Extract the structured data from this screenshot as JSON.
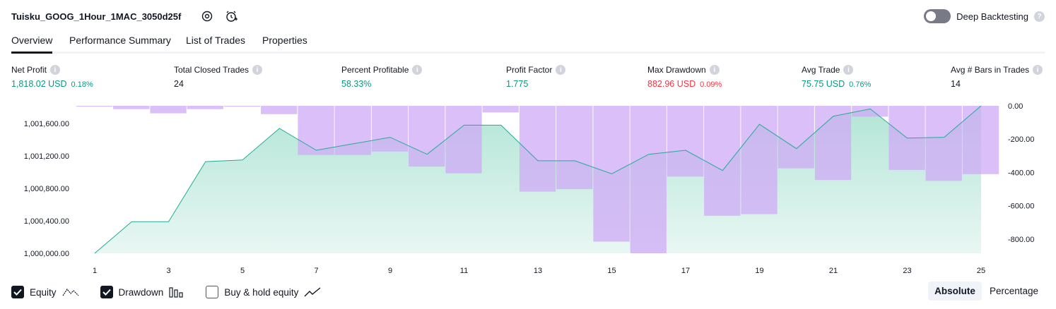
{
  "header": {
    "strategy_name": "Tuisku_GOOG_1Hour_1MAC_3050d25f",
    "settings_icon": "settings-gear-icon",
    "alert_icon": "add-alert-clock-icon",
    "deep_backtesting_label": "Deep Backtesting",
    "deep_backtesting_enabled": false,
    "help_icon_glyph": "?"
  },
  "tabs": [
    {
      "label": "Overview",
      "active": true
    },
    {
      "label": "Performance Summary",
      "active": false
    },
    {
      "label": "List of Trades",
      "active": false
    },
    {
      "label": "Properties",
      "active": false
    }
  ],
  "metrics": [
    {
      "label": "Net Profit",
      "value": "1,818.02 USD",
      "pct": "0.18%",
      "color": "green"
    },
    {
      "label": "Total Closed Trades",
      "value": "24",
      "pct": "",
      "color": "dark"
    },
    {
      "label": "Percent Profitable",
      "value": "58.33%",
      "pct": "",
      "color": "green"
    },
    {
      "label": "Profit Factor",
      "value": "1.775",
      "pct": "",
      "color": "green"
    },
    {
      "label": "Max Drawdown",
      "value": "882.96 USD",
      "pct": "0.09%",
      "color": "red"
    },
    {
      "label": "Avg Trade",
      "value": "75.75 USD",
      "pct": "0.76%",
      "color": "green"
    },
    {
      "label": "Avg # Bars in Trades",
      "value": "14",
      "pct": "",
      "color": "dark"
    }
  ],
  "chart_data": {
    "type": "area",
    "x": [
      1,
      2,
      3,
      4,
      5,
      6,
      7,
      8,
      9,
      10,
      11,
      12,
      13,
      14,
      15,
      16,
      17,
      18,
      19,
      20,
      21,
      22,
      23,
      24,
      25
    ],
    "x_tick_labels": [
      "1",
      "3",
      "5",
      "7",
      "9",
      "11",
      "13",
      "15",
      "17",
      "19",
      "21",
      "23",
      "25"
    ],
    "series": [
      {
        "axis": "left",
        "style": "area",
        "values": [
          1000000,
          1000390,
          1000390,
          1001130,
          1001150,
          1001540,
          1001270,
          1001350,
          1001430,
          1001220,
          1001580,
          1001580,
          1001140,
          1001140,
          1000980,
          1001220,
          1001270,
          1001020,
          1001590,
          1001290,
          1001690,
          1001780,
          1001420,
          1001430,
          1001818
        ]
      },
      {
        "axis": "right",
        "style": "bar",
        "values": [
          -5,
          -20,
          -45,
          -20,
          -5,
          -50,
          -295,
          -295,
          -275,
          -365,
          -405,
          -40,
          -515,
          -500,
          -815,
          -885,
          -425,
          -660,
          -650,
          -375,
          -445,
          -65,
          -385,
          -450,
          -410
        ]
      }
    ],
    "left_axis": {
      "ticks": [
        "1,000,000.00",
        "1,000,400.00",
        "1,000,800.00",
        "1,001,200.00",
        "1,001,600.00"
      ],
      "range": [
        1000000,
        1001818
      ]
    },
    "right_axis": {
      "ticks": [
        "0.00",
        "-200.00",
        "-400.00",
        "-600.00",
        "-800.00"
      ],
      "range": [
        -885,
        0
      ]
    },
    "colors": {
      "equity_line": "#22ab94",
      "equity_fill": "#b2e5d6",
      "drawdown_fill": "#cfa9f5"
    }
  },
  "legend": [
    {
      "label": "Equity",
      "checked": true,
      "icon": "equity-line-icon"
    },
    {
      "label": "Drawdown",
      "checked": true,
      "icon": "drawdown-bars-icon"
    },
    {
      "label": "Buy & hold equity",
      "checked": false,
      "icon": "buy-hold-line-icon"
    }
  ],
  "view_modes": [
    {
      "label": "Absolute",
      "active": true
    },
    {
      "label": "Percentage",
      "active": false
    }
  ]
}
